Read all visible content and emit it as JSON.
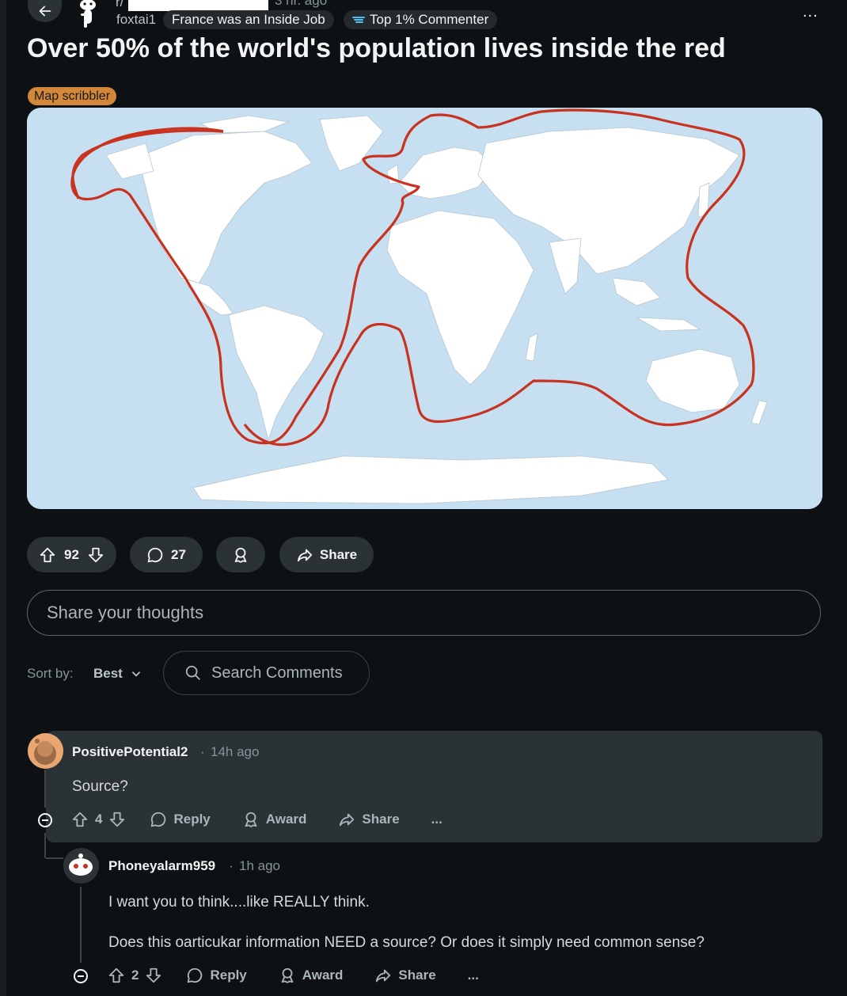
{
  "header": {
    "subreddit_prefix": "r/",
    "time_ago": "3 hr. ago",
    "author": "foxtai1",
    "user_flair": "France was an Inside Job",
    "badge_flair": "Top 1% Commenter",
    "more": "..."
  },
  "post": {
    "title": "Over 50% of the world's population lives inside the red",
    "flair": "Map scribbler",
    "flair_color": "#d2873a",
    "map_line_color": "#c8321e"
  },
  "actions": {
    "score": "92",
    "comments": "27",
    "share_label": "Share"
  },
  "composer": {
    "placeholder": "Share your thoughts"
  },
  "sort": {
    "label": "Sort by:",
    "value": "Best"
  },
  "search": {
    "placeholder": "Search Comments"
  },
  "comments": [
    {
      "user": "PositivePotential2",
      "time": "14h ago",
      "body": "Source?",
      "score": "4",
      "reply": "Reply",
      "award": "Award",
      "share": "Share",
      "more": "..."
    },
    {
      "user": "Phoneyalarm959",
      "time": "1h ago",
      "body_lines": [
        "I want you to think....like REALLY think.",
        "Does this oarticukar information NEED a source? Or does it simply need common sense?"
      ],
      "score": "2",
      "reply": "Reply",
      "award": "Award",
      "share": "Share",
      "more": "..."
    }
  ]
}
